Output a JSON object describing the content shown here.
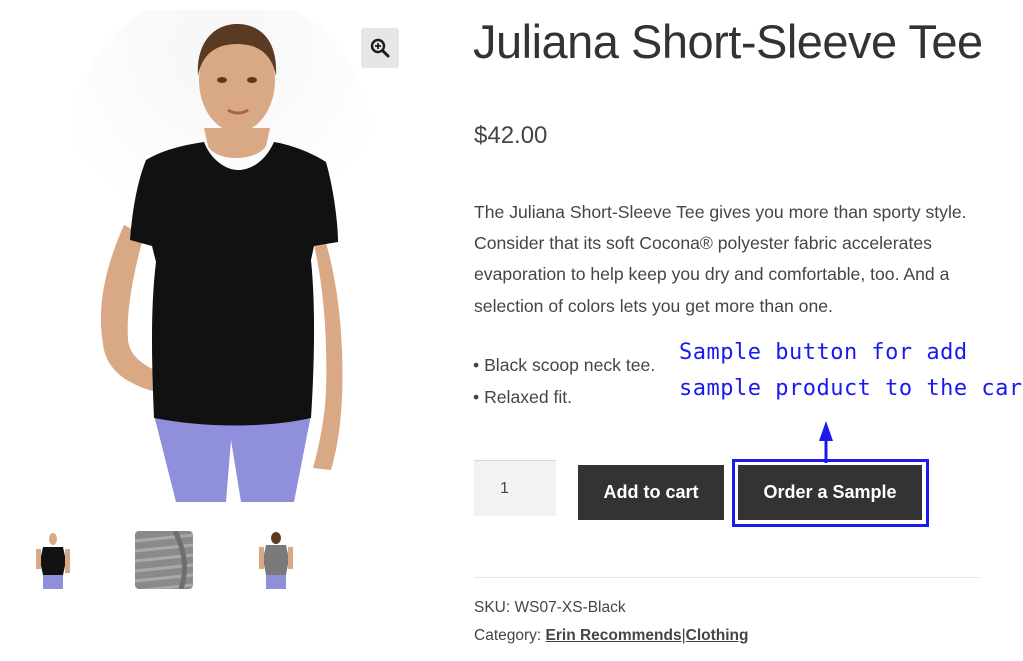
{
  "product": {
    "title": "Juliana Short-Sleeve Tee",
    "price": "$42.00",
    "description": "The Juliana Short-Sleeve Tee gives you more than sporty style. Consider that its soft Cocona® polyester fabric accelerates evaporation to help keep you dry and comfortable, too. And a selection of colors lets you get more than one.",
    "bullets": [
      "Black scoop neck tee.",
      "Relaxed fit."
    ]
  },
  "gallery": {
    "zoom_icon": "magnifier-plus-icon",
    "thumbnails": [
      "front-view",
      "fabric-closeup",
      "back-view"
    ],
    "colors": {
      "shirt": "#111111",
      "leggings": "#8f8fdc",
      "skin": "#d9a986",
      "hair": "#5a3a22"
    }
  },
  "cart": {
    "quantity": "1",
    "add_to_cart_label": "Add to cart",
    "order_sample_label": "Order a Sample"
  },
  "annotation": {
    "line1": "Sample button for add",
    "line2": "sample product to the cart.",
    "color": "#1a1aee"
  },
  "meta": {
    "sku_label": "SKU:",
    "sku_value": "WS07-XS-Black",
    "category_label": "Category:",
    "categories": [
      "Erin Recommends",
      "Clothing"
    ],
    "category_separator": "|"
  }
}
